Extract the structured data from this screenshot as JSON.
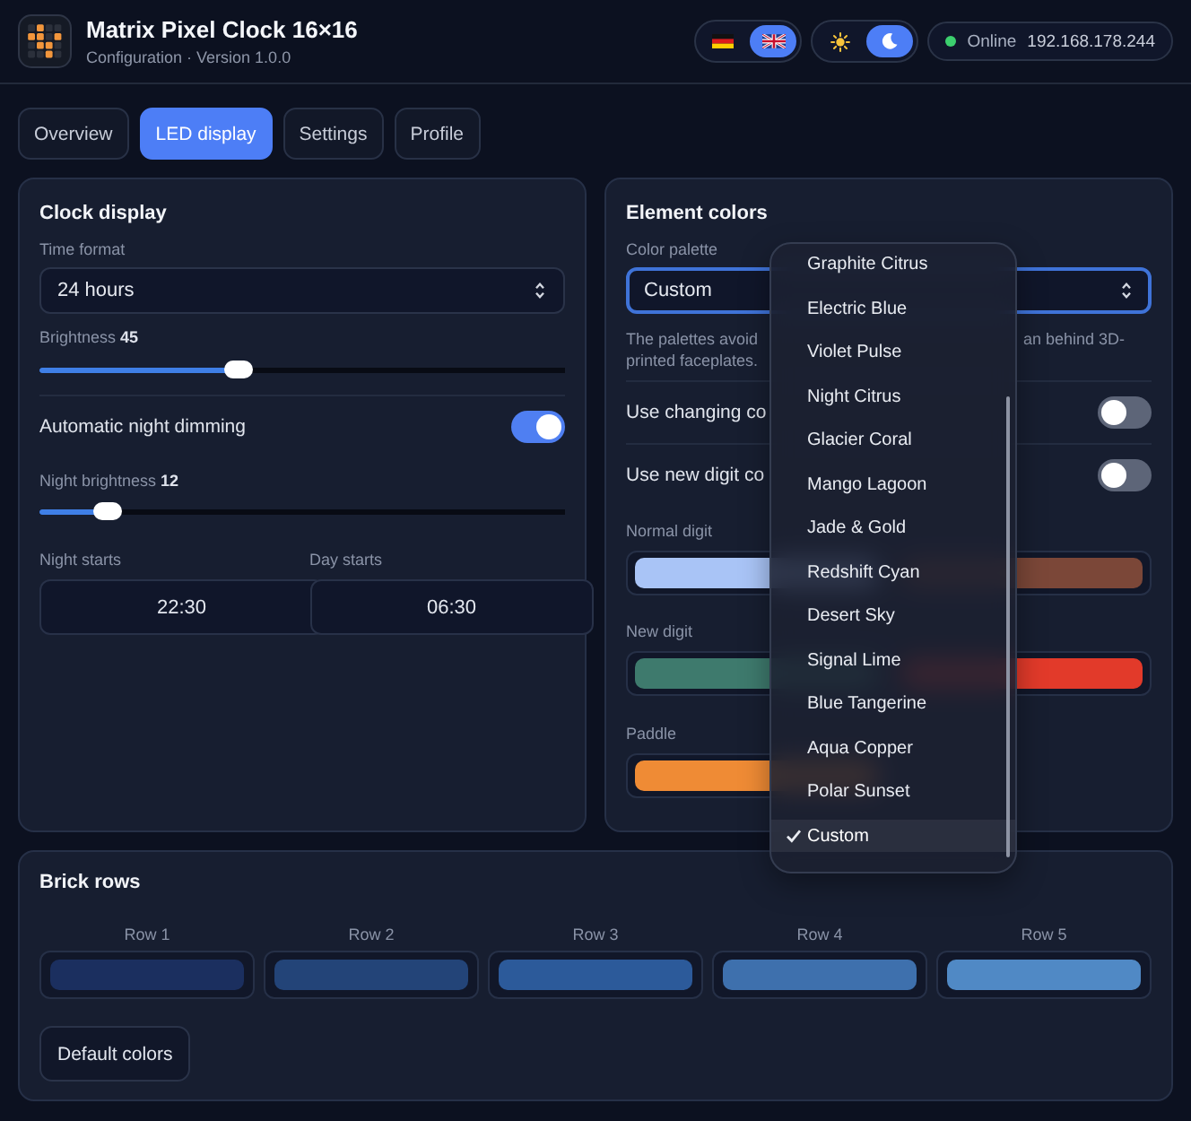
{
  "header": {
    "title": "Matrix Pixel Clock 16×16",
    "subtitle": "Configuration · Version 1.0.0",
    "languages": [
      {
        "kind": "german",
        "selected": false
      },
      {
        "kind": "british",
        "selected": true
      }
    ],
    "themes": [
      {
        "kind": "light",
        "selected": false
      },
      {
        "kind": "dark",
        "selected": true
      }
    ],
    "status": {
      "online": true,
      "label": "Online",
      "address": "192.168.178.244"
    }
  },
  "tabs": [
    {
      "label": "Overview",
      "selected": false
    },
    {
      "label": "LED display",
      "selected": true
    },
    {
      "label": "Settings",
      "selected": false
    },
    {
      "label": "Profile",
      "selected": false
    }
  ],
  "clock_display": {
    "title": "Clock display",
    "time_format": {
      "label": "Time format",
      "value": "24 hours"
    },
    "brightness": {
      "label": "Brightness **45**",
      "level": 0.38
    },
    "night_dimming": {
      "label": "Automatic night dimming",
      "on": true
    },
    "night_brightness": {
      "label": "Night brightness **12**",
      "level": 0.13
    },
    "times": [
      {
        "label": "Night starts",
        "value": "22:30"
      },
      {
        "label": "Day starts",
        "value": "06:30"
      }
    ]
  },
  "element_colors": {
    "title": "Element colors",
    "palette": {
      "label": "Color palette",
      "value": "Custom",
      "focused": true,
      "options": [
        {
          "label": "Graphite Citrus",
          "selected": false
        },
        {
          "label": "Electric Blue",
          "selected": false
        },
        {
          "label": "Violet Pulse",
          "selected": false
        },
        {
          "label": "Night Citrus",
          "selected": false
        },
        {
          "label": "Glacier Coral",
          "selected": false
        },
        {
          "label": "Mango Lagoon",
          "selected": false
        },
        {
          "label": "Jade & Gold",
          "selected": false
        },
        {
          "label": "Redshift Cyan",
          "selected": false
        },
        {
          "label": "Desert Sky",
          "selected": false
        },
        {
          "label": "Signal Lime",
          "selected": false
        },
        {
          "label": "Blue Tangerine",
          "selected": false
        },
        {
          "label": "Aqua Copper",
          "selected": false
        },
        {
          "label": "Polar Sunset",
          "selected": false
        },
        {
          "label": "Custom",
          "selected": true
        }
      ]
    },
    "hint_lines": [
      [
        "The palettes avoid",
        "an behind 3D-"
      ],
      [
        "printed faceplates."
      ]
    ],
    "toggles": [
      {
        "label": "Use changing co",
        "on": false
      },
      {
        "label": "Use new digit co",
        "on": false
      }
    ],
    "color_fields": [
      {
        "label": "Normal digit",
        "swatches": [
          {
            "color": "#a9c4f6"
          },
          {
            "color": "#7b4738"
          }
        ]
      },
      {
        "label": "New digit",
        "swatches": [
          {
            "color": "#3e7a6d"
          },
          {
            "color": "#e23a2a"
          }
        ]
      },
      {
        "label": "Paddle",
        "swatches": [
          {
            "color": "#ef8b35"
          }
        ]
      }
    ]
  },
  "brick_rows": {
    "title": "Brick rows",
    "rows": [
      {
        "label": "Row 1",
        "color": "#1b2f5f"
      },
      {
        "label": "Row 2",
        "color": "#234478"
      },
      {
        "label": "Row 3",
        "color": "#2c5a9a"
      },
      {
        "label": "Row 4",
        "color": "#3e70ad"
      },
      {
        "label": "Row 5",
        "color": "#5089c5"
      }
    ],
    "button": "Default colors"
  }
}
